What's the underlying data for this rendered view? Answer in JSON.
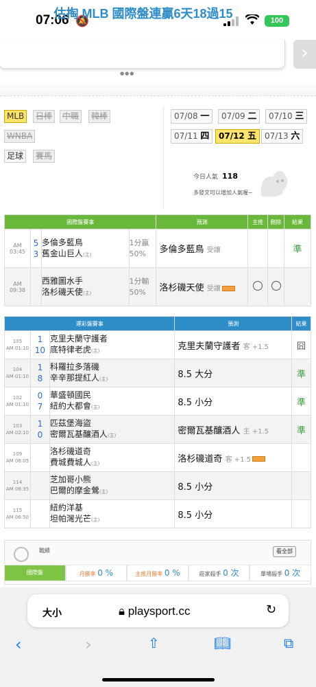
{
  "status": {
    "time": "07:06",
    "battery": "100"
  },
  "banner": {
    "text": "估掏 MLB 國際盤連贏6天18過15"
  },
  "leagues": [
    {
      "label": "MLB",
      "active": true
    },
    {
      "label": "日棒"
    },
    {
      "label": "中職"
    },
    {
      "label": "韓棒"
    },
    {
      "label": "WNBA"
    },
    {
      "label": "足球"
    },
    {
      "label": "賽馬"
    }
  ],
  "dates": [
    {
      "label": "07/08",
      "day": "一"
    },
    {
      "label": "07/09",
      "day": "二"
    },
    {
      "label": "07/10",
      "day": "三"
    },
    {
      "label": "07/11",
      "day": "四"
    },
    {
      "label": "07/12",
      "day": "五",
      "active": true
    },
    {
      "label": "07/13",
      "day": "六"
    }
  ],
  "popularity": {
    "label": "今日人氣",
    "value": "118",
    "note": "多發文可以增加人氣喔~"
  },
  "intl": {
    "headers": [
      "國際盤賽事",
      "預測",
      "主推",
      "刪除",
      "結果"
    ],
    "rows": [
      {
        "time": "AM 03:45",
        "s1": "5",
        "t1": "多倫多藍鳥",
        "s2": "3",
        "t2": "舊金山巨人",
        "home": "(主)",
        "o1": "1分贏",
        "o2": "50%",
        "pick": "多倫多藍鳥",
        "pnote": "受讓",
        "result": "準"
      },
      {
        "time": "AM 09:38",
        "s1": "",
        "t1": "西雅圖水手",
        "s2": "",
        "t2": "洛杉磯天使",
        "home": "(主)",
        "o1": "1分輸",
        "o2": "50%",
        "pick": "洛杉磯天使",
        "pnote": "受讓",
        "result": ""
      }
    ]
  },
  "lottery": {
    "headers": [
      "運彩盤賽事",
      "預測",
      "結果"
    ],
    "rows": [
      {
        "num": "105",
        "time": "AM 01:10",
        "s1": "1",
        "t1": "克里夫蘭守護者",
        "s2": "10",
        "t2": "底特律老虎",
        "pick": "克里夫蘭守護者",
        "pnote": "客 +1.5",
        "result": "囧"
      },
      {
        "num": "104",
        "time": "AM 01:10",
        "s1": "1",
        "t1": "科羅拉多落磯",
        "s2": "8",
        "t2": "辛辛那提紅人",
        "pick": "8.5 大分",
        "pnote": "",
        "result": "準"
      },
      {
        "num": "102",
        "time": "AM 01:10",
        "s1": "0",
        "t1": "華盛頓國民",
        "s2": "7",
        "t2": "紐約大都會",
        "pick": "8.5 小分",
        "pnote": "",
        "result": "準"
      },
      {
        "num": "103",
        "time": "AM 02:10",
        "s1": "1",
        "t1": "匹茲堡海盜",
        "s2": "0",
        "t2": "密爾瓦基釀酒人",
        "pick": "密爾瓦基釀酒人",
        "pnote": "主 +1.5",
        "result": "準"
      },
      {
        "num": "109",
        "time": "AM 06:05",
        "s1": "",
        "t1": "洛杉磯道奇",
        "s2": "",
        "t2": "費城費城人",
        "pick": "洛杉磯道奇",
        "pnote": "客 +1.5",
        "result": ""
      },
      {
        "num": "114",
        "time": "AM 06:35",
        "s1": "",
        "t1": "芝加哥小熊",
        "s2": "",
        "t2": "巴爾的摩金鶯",
        "pick": "8.5 小分",
        "pnote": "",
        "result": ""
      },
      {
        "num": "115",
        "time": "AM 06:50",
        "s1": "",
        "t1": "紐約洋基",
        "s2": "",
        "t2": "坦帕灣光芒",
        "pick": "8.5 小分",
        "pnote": "",
        "result": ""
      }
    ],
    "home": "(主)"
  },
  "stats": {
    "title": "戰績",
    "view_all": "看全部",
    "tabs": [
      {
        "label": "國際盤",
        "value": ""
      },
      {
        "label": "月勝率",
        "value": "0 %"
      },
      {
        "label": "主推月勝率",
        "value": "0 %"
      },
      {
        "label": "莊家殺手",
        "value": "0 次"
      },
      {
        "label": "單場殺手",
        "value": "0 次"
      }
    ]
  },
  "browser": {
    "text_size": "大小",
    "url": "playsport.cc"
  },
  "colors": {
    "green": "#6ab83b",
    "blue": "#2e8cc6",
    "highlight": "#ffe46a"
  }
}
